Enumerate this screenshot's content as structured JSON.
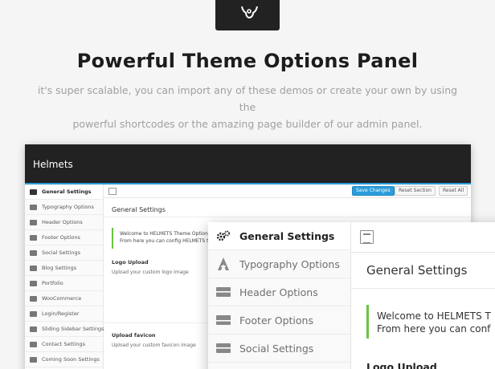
{
  "hero": {
    "icon": "gear-icon",
    "title": "Powerful Theme Options Panel",
    "subtitle_line1": "it's super scalable, you can import any of these demos or create your own by using the",
    "subtitle_line2": "powerful shortcodes or the amazing page builder of our admin panel."
  },
  "admin": {
    "brand": "Helmets",
    "accent_color": "#2b9ddb",
    "sidebar_items": [
      {
        "label": "General Settings",
        "icon": "gears-icon"
      },
      {
        "label": "Typography Options",
        "icon": "typography-icon"
      },
      {
        "label": "Header Options",
        "icon": "header-icon"
      },
      {
        "label": "Footer Options",
        "icon": "footer-icon"
      },
      {
        "label": "Social Settings",
        "icon": "social-icon"
      },
      {
        "label": "Blog Settings",
        "icon": "blog-icon"
      },
      {
        "label": "Portfolio",
        "icon": "portfolio-icon"
      },
      {
        "label": "WooCommerce",
        "icon": "cart-icon"
      },
      {
        "label": "Login/Register",
        "icon": "user-icon"
      },
      {
        "label": "Sliding Sidebar Settings",
        "icon": "list-icon"
      },
      {
        "label": "Contact Settings",
        "icon": "contact-icon"
      },
      {
        "label": "Coming Soon Settings",
        "icon": "clock-icon"
      }
    ],
    "buttons": {
      "save": "Save Changes",
      "reset_section": "Reset Section",
      "reset_all": "Reset All"
    },
    "section_title": "General Settings",
    "notice_title": "Welcome to HELMETS Theme Options",
    "notice_text": "From here you can config HELMETS theme",
    "notice_color": "#6ac43f",
    "fields": [
      {
        "label": "Logo Upload",
        "desc": "Upload your custom logo image"
      },
      {
        "label": "Upload favicon",
        "desc": "Upload your custom favicon image"
      }
    ]
  },
  "zoom": {
    "sidebar_items": [
      {
        "label": "General Settings"
      },
      {
        "label": "Typography Options"
      },
      {
        "label": "Header Options"
      },
      {
        "label": "Footer Options"
      },
      {
        "label": "Social Settings"
      }
    ],
    "section_title": "General Settings",
    "notice_title": "Welcome to HELMETS T",
    "notice_text": "From here you can conf",
    "field_label": "Logo Upload"
  }
}
